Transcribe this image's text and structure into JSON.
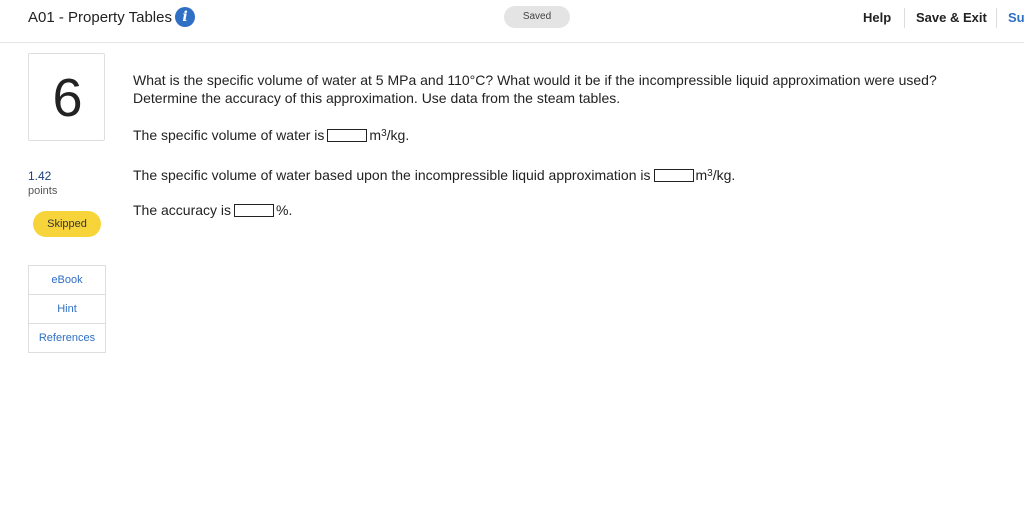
{
  "header": {
    "title": "A01 - Property Tables",
    "info_icon": "info-icon",
    "saved_label": "Saved",
    "help_label": "Help",
    "save_exit_label": "Save & Exit",
    "submit_label": "Su",
    "colors": {
      "accent": "#2f6fc4",
      "saved_bg": "#e4e4e4"
    }
  },
  "question_panel": {
    "number": "6",
    "points_value": "1.42",
    "points_label": "points",
    "status_badge": "Skipped",
    "status_color": "#f7d53a",
    "resources": [
      {
        "label": "eBook"
      },
      {
        "label": "Hint"
      },
      {
        "label": "References"
      }
    ]
  },
  "question": {
    "prompt": "What is the specific volume of water at 5 MPa and 110°C? What would it be if the incompressible liquid approximation were used? Determine the accuracy of this approximation. Use data from the steam tables.",
    "answers": [
      {
        "label": "The specific volume of water is",
        "unit_base": "m",
        "unit_exp": "3",
        "unit_tail": "/kg.",
        "value": ""
      },
      {
        "label": "The specific volume of water based upon the incompressible liquid approximation is",
        "unit_base": "m",
        "unit_exp": "3",
        "unit_tail": "/kg.",
        "value": ""
      },
      {
        "label": "The accuracy is",
        "unit_base": "%.",
        "unit_exp": "",
        "unit_tail": "",
        "value": ""
      }
    ]
  }
}
